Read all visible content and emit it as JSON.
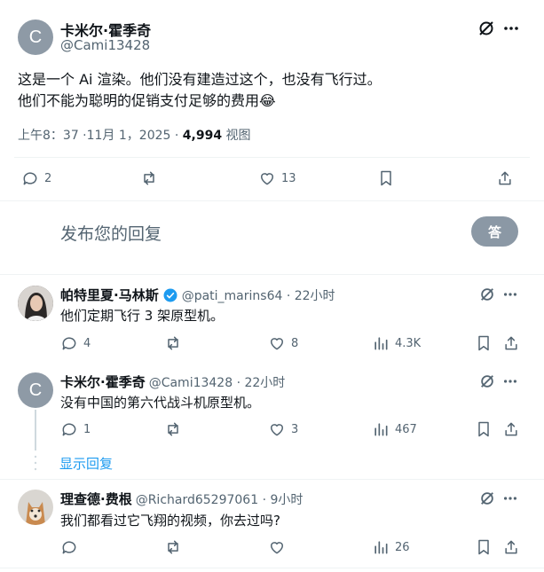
{
  "main_post": {
    "author_name": "卡米尔·霍季奇",
    "author_handle": "@Cami13428",
    "avatar_letter": "C",
    "text_line1": "这是一个 Ai 渲染。他们没有建造过这个，也没有飞行过。",
    "text_line2": "他们不能为聪明的促销支付足够的费用😂",
    "time": "上午8：37 ·11月 1，2025 ·",
    "views_count": "4,994",
    "views_label": "视图",
    "actions": {
      "replies": "2",
      "likes": "13"
    }
  },
  "composer": {
    "placeholder": "发布您的回复",
    "reply_button": "答"
  },
  "replies": [
    {
      "author_name": "帕特里夏·马林斯",
      "author_handle": "@pati_marins64 · 22小时",
      "text": "他们定期飞行 3 架原型机。",
      "replies": "4",
      "reposts": "",
      "likes": "8",
      "views": "4.3K",
      "verified": true
    },
    {
      "author_name": "卡米尔·霍季奇",
      "author_handle": "@Cami13428 · 22小时",
      "avatar_letter": "C",
      "text": "没有中国的第六代战斗机原型机。",
      "replies": "1",
      "reposts": "",
      "likes": "3",
      "views": "467"
    },
    {
      "author_name": "理查德·费根",
      "author_handle": "@Richard65297061 · 9小时",
      "text": "我们都看过它飞翔的视频，你去过吗?",
      "replies": "",
      "reposts": "",
      "likes": "",
      "views": "26"
    }
  ],
  "show_replies": "显示回复",
  "icons": {
    "grok": "grok-icon",
    "more": "more-icon",
    "reply": "reply-icon",
    "repost": "repost-icon",
    "like": "like-icon",
    "bookmark": "bookmark-icon",
    "share": "share-icon",
    "views": "views-icon",
    "verified": "verified-badge-icon"
  },
  "colors": {
    "text": "#0f1419",
    "muted": "#536471",
    "link": "#1d9bf0",
    "button": "#8b98a5"
  }
}
